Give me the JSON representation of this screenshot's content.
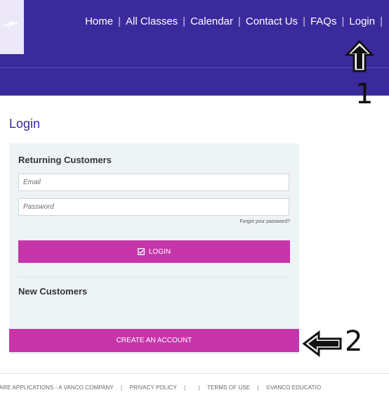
{
  "header": {
    "nav": [
      {
        "id": "home",
        "label": "Home"
      },
      {
        "id": "all-classes",
        "label": "All Classes"
      },
      {
        "id": "calendar",
        "label": "Calendar"
      },
      {
        "id": "contact-us",
        "label": "Contact Us"
      },
      {
        "id": "faqs",
        "label": "FAQs"
      },
      {
        "id": "login",
        "label": "Login"
      }
    ],
    "separator": "|",
    "bg_color": "#3a2a9c"
  },
  "annotations": {
    "step1": "1",
    "step2": "2"
  },
  "login": {
    "title": "Login",
    "returning_title": "Returning Customers",
    "email_placeholder": "Email",
    "password_placeholder": "Password",
    "email_value": "",
    "password_value": "",
    "forgot_label": "Forgot your password?",
    "login_button": "LOGIN",
    "new_title": "New Customers",
    "create_button": "CREATE AN ACCOUNT",
    "accent_color": "#c635a9"
  },
  "footer": {
    "company": "VARE APPLICATIONS - A VANCO COMPANY",
    "privacy": "PRIVACY POLICY",
    "terms": "TERMS OF USE",
    "copyright": "©VANCO EDUCATIO"
  },
  "icons": {
    "logo": "logo-mark-icon",
    "up_arrow": "up-arrow-icon",
    "left_arrow": "left-arrow-icon",
    "login_check": "checkbox-check-icon"
  }
}
